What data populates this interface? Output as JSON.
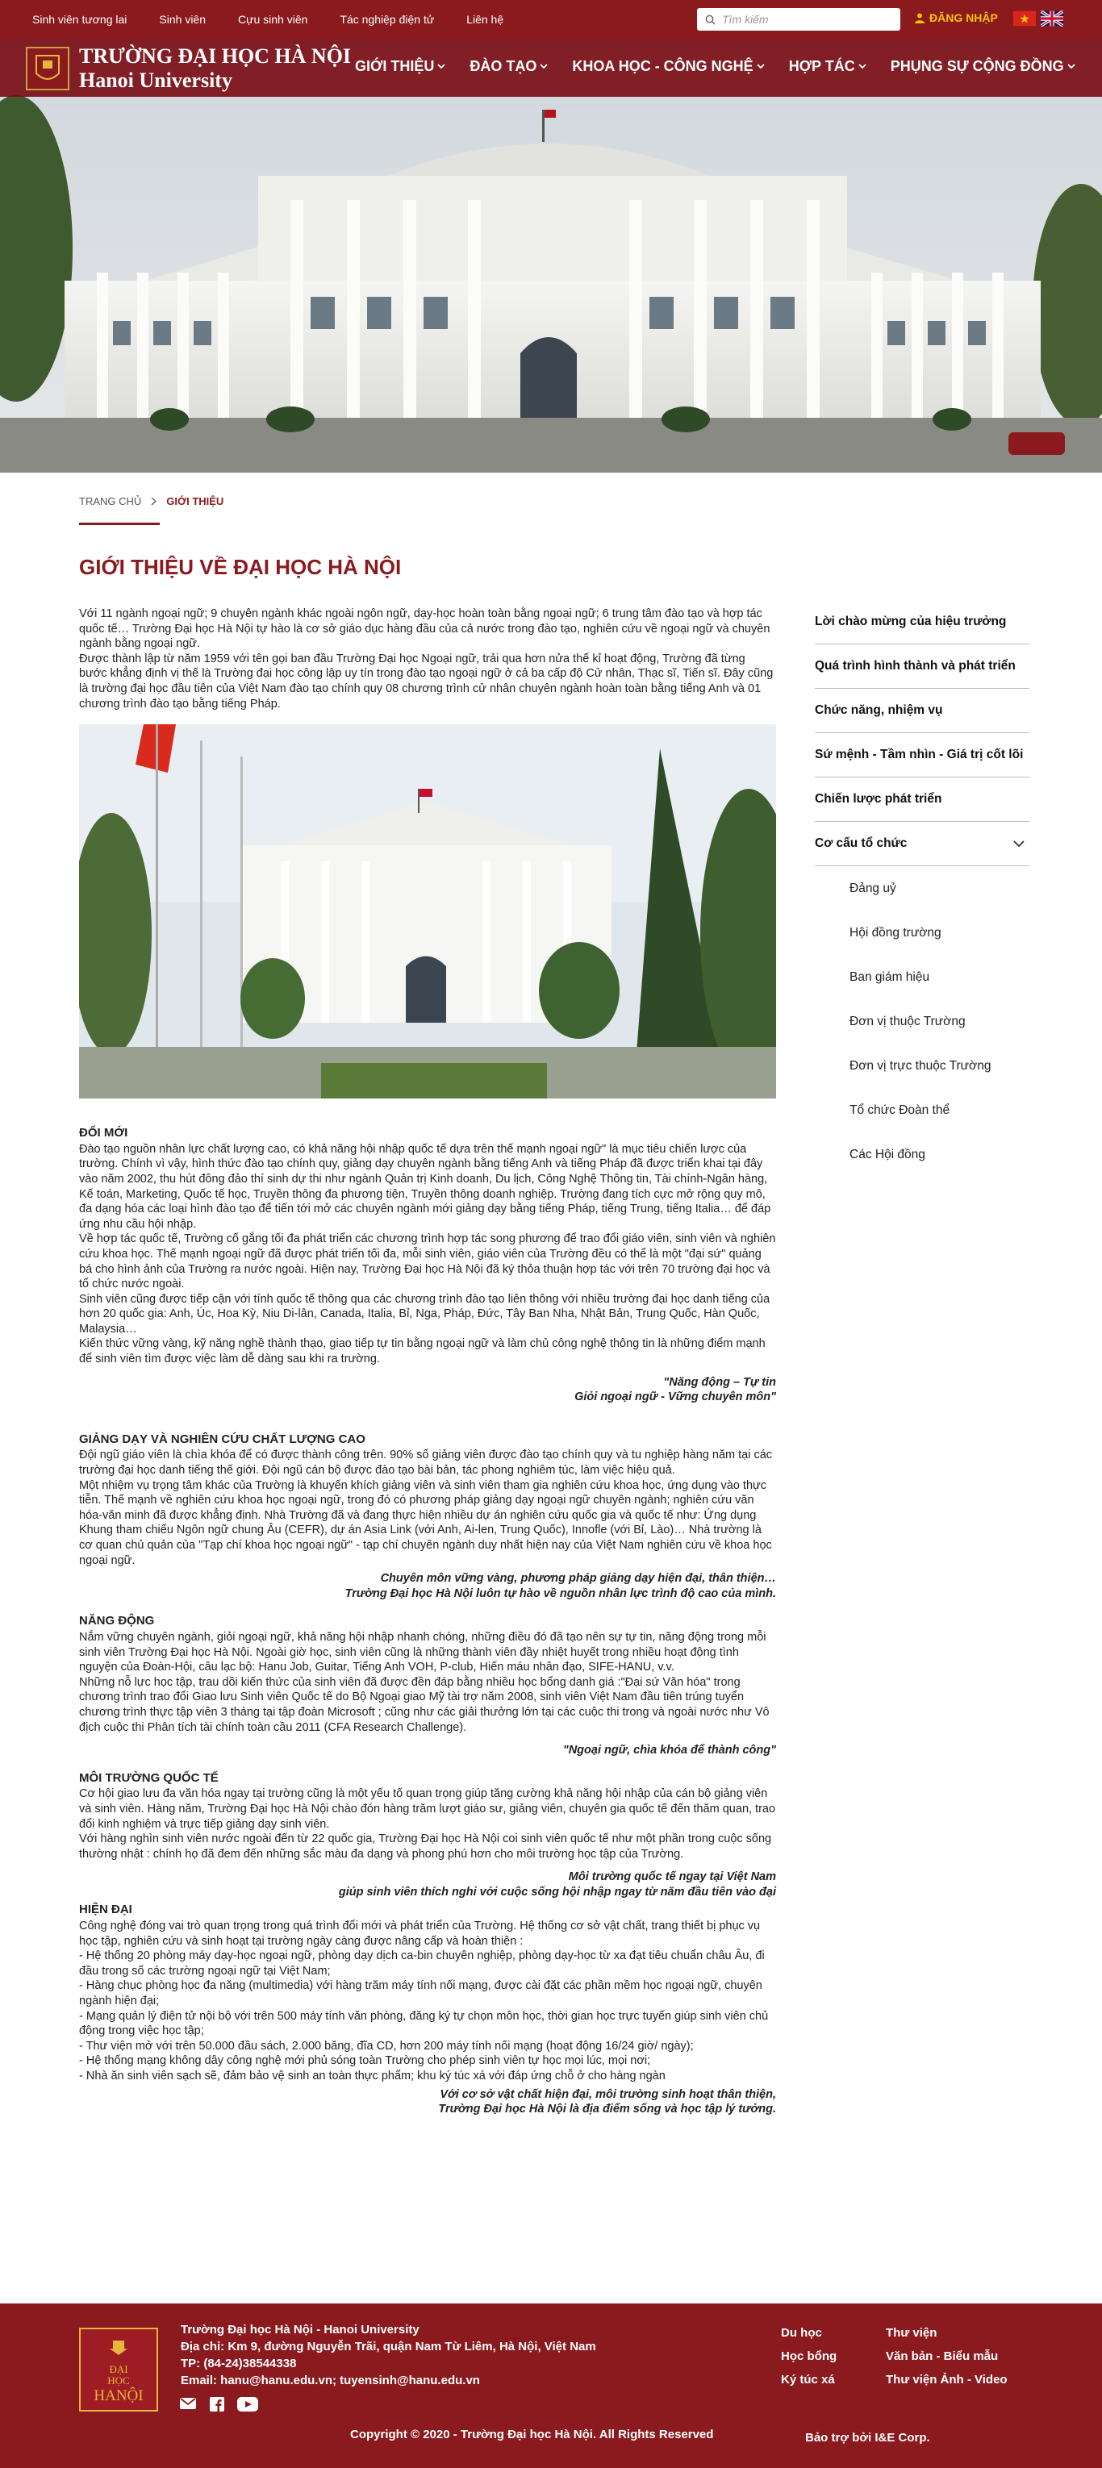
{
  "topbar": {
    "links": [
      "Sinh viên tương lai",
      "Sinh viên",
      "Cựu sinh viên",
      "Tác nghiệp điện tử",
      "Liên hệ"
    ],
    "search_placeholder": "Tìm kiếm",
    "login_label": "ĐĂNG NHẬP",
    "colors": {
      "bar": "#8b1a1f",
      "login": "#f5c400"
    }
  },
  "nav": {
    "brand_line1": "TRƯỜNG ĐẠI HỌC HÀ NỘI",
    "brand_line2": "Hanoi University",
    "menu": [
      "GIỚI THIỆU",
      "ĐÀO TẠO",
      "KHOA HỌC - CÔNG NGHỆ",
      "HỢP TÁC",
      "PHỤNG SỰ CỘNG ĐỒNG"
    ]
  },
  "breadcrumb": {
    "home": "TRANG CHỦ",
    "current": "GIỚI THIỆU"
  },
  "page_title": "GIỚI THIỆU VỀ ĐẠI HỌC HÀ NỘI",
  "content": {
    "intro": [
      "Với 11 ngành ngoại ngữ; 9 chuyên ngành khác ngoài ngôn ngữ, dạy-học hoàn toàn bằng ngoại ngữ; 6 trung tâm đào tạo và hợp tác quốc tế… Trường Đại học Hà Nội tự hào là cơ sở giáo dục hàng đầu của cả nước trong đào tạo, nghiên cứu về ngoại ngữ và chuyên ngành bằng ngoại ngữ.",
      "Được thành lập từ năm 1959 với tên gọi ban đầu Trường Đại học Ngoại ngữ, trải qua hơn nửa thế kỉ hoạt động, Trường đã từng bước khẳng định vị thế là Trường đại học công lập uy tín trong đào tạo ngoại ngữ ở cả ba cấp độ Cử nhân, Thạc sĩ, Tiến sĩ. Đây cũng là trường đại học đầu tiên của Việt Nam đào tạo chính quy 08 chương trình cử nhân chuyên ngành hoàn toàn bằng tiếng Anh và 01 chương trình đào tạo bằng tiếng Pháp."
    ],
    "s1_title": "ĐỔI MỚI",
    "s1": [
      "Đào tạo nguồn nhân lực chất lượng cao, có khả năng hội nhập quốc tế dựa trên thế mạnh ngoại ngữ\" là mục tiêu chiến lược của trường. Chính vì vậy, hình thức đào tạo chính quy, giảng dạy chuyên ngành bằng tiếng Anh và tiếng Pháp đã được triển khai tại đây vào năm 2002, thu hút đông đảo thí sinh dự thi như ngành Quản trị Kinh doanh, Du lịch, Công Nghệ Thông tin, Tài chính-Ngân hàng, Kế toán, Marketing, Quốc tế học, Truyền thông đa phương tiện, Truyền thông doanh nghiệp. Trường đang tích cực mở rộng quy mô, đa dạng hóa các loại hình đào tạo để tiến tới mở các chuyên ngành mới giảng dạy bằng tiếng Pháp, tiếng Trung, tiếng Italia… để đáp ứng nhu cầu hội nhập.",
      "Về hợp tác quốc tế, Trường cố gắng tối đa phát triển các chương trình hợp tác song phương để trao đổi giáo viên, sinh viên và nghiên cứu khoa học. Thế mạnh ngoại ngữ đã được phát triển tối đa, mỗi sinh viên, giáo viên của Trường đều có thể là một \"đại sứ\" quảng bá cho hình ảnh của Trường ra nước ngoài. Hiện nay, Trường Đại học Hà Nội đã ký thỏa thuận hợp tác với trên 70 trường đại học và tổ chức nước ngoài.",
      "Sinh viên cũng được tiếp cận với tính quốc tế thông qua các chương trình đào tạo liên thông với nhiều trường đại học danh tiếng của hơn 20 quốc gia: Anh, Úc, Hoa Kỳ, Niu Di-lân, Canada, Italia, Bỉ, Nga, Pháp, Đức, Tây Ban Nha, Nhật Bản, Trung Quốc, Hàn Quốc, Malaysia…",
      "Kiến thức vững vàng, kỹ năng nghề thành thạo, giao tiếp tự tin bằng ngoại ngữ và làm chủ công nghệ thông tin là những điểm mạnh để sinh viên tìm được việc làm dễ dàng sau khi ra trường."
    ],
    "s1_quote": [
      "\"Năng động – Tự tin",
      "Giỏi ngoại ngữ - Vững chuyên môn\""
    ],
    "s2_title": "GIẢNG DẠY VÀ NGHIÊN CỨU CHẤT LƯỢNG CAO",
    "s2": [
      "Đội ngũ giáo viên là chìa khóa để có được thành công trên. 90% số giảng viên được đào tạo chính quy và tu nghiệp hàng năm tại các trường đại học danh tiếng thế giới. Đội ngũ cán bộ được đào tạo bài bản, tác phong nghiêm túc, làm việc hiệu quả.",
      "Một nhiệm vụ trọng tâm khác của Trường là khuyến khích giảng viên và sinh viên tham gia nghiên cứu khoa học, ứng dụng vào thực tiễn. Thế mạnh về nghiên cứu khoa học ngoại ngữ, trong đó có phương pháp giảng dạy ngoại ngữ chuyên ngành; nghiên cứu văn hóa-văn minh đã được khẳng định. Nhà Trường đã và đang thực hiện nhiều dự án nghiên cứu quốc gia và quốc tế như: Ứng dụng Khung tham chiếu Ngôn ngữ chung Âu (CEFR), dự án Asia Link (với Anh, Ai-len, Trung Quốc), Innofle (với Bỉ, Lào)… Nhà trường là cơ quan chủ quản của \"Tạp chí khoa học ngoại ngữ\" - tạp chí chuyên ngành duy nhất hiện nay của Việt Nam nghiên cứu về khoa học ngoại ngữ."
    ],
    "s2_quote": [
      "Chuyên môn vững vàng, phương pháp giảng dạy hiện đại, thân thiện…",
      "Trường Đại học Hà Nội luôn tự hào về nguồn nhân lực trình độ cao của mình."
    ],
    "s3_title": "NĂNG ĐỘNG",
    "s3": [
      "Nắm vững chuyên ngành, giỏi ngoại ngữ, khả năng hội nhập nhanh chóng, những điều đó đã tạo nên sự tự tin, năng động trong mỗi sinh viên Trường Đại học Hà Nội. Ngoài giờ học, sinh viên cũng là những thành viên đầy nhiệt huyết trong nhiều hoạt động tình nguyện của Đoàn-Hội, câu lạc bộ: Hanu Job, Guitar, Tiếng Anh VOH, P-club, Hiến máu nhân đạo, SIFE-HANU, v.v.",
      "Những nỗ lực học tập, trau dồi kiến thức của sinh viên đã được đền đáp bằng nhiều học bổng danh giá :\"Đại sứ Văn hóa\" trong chương trình trao đổi Giao lưu Sinh viên Quốc tế do Bộ Ngoại giao Mỹ tài trợ năm 2008, sinh viên Việt Nam đầu tiên trúng tuyển chương trình thực tập viên 3 tháng tại tập đoàn Microsoft ; cũng như các giải thưởng lớn tại các cuộc thi trong và ngoài nước như Vô địch cuộc thi Phân tích tài chính toàn cầu 2011 (CFA Research Challenge)."
    ],
    "s3_quote": [
      "\"Ngoại ngữ, chìa khóa để thành công\""
    ],
    "s4_title": "MÔI TRƯỜNG QUỐC TẾ",
    "s4": [
      "Cơ hội giao lưu đa văn hóa ngay tại trường cũng là một yếu tố quan trọng giúp tăng cường khả năng hội nhập của cán bộ giảng viên và sinh viên. Hàng năm, Trường Đại học Hà Nội chào đón hàng trăm lượt giáo sư, giảng viên, chuyên gia quốc tế đến thăm quan, trao đổi kinh nghiệm và trực tiếp giảng dạy sinh viên.",
      "Với hàng nghìn sinh viên nước ngoài đến từ 22 quốc gia, Trường Đại học Hà Nội coi sinh viên quốc tế như một phần trong cuộc sống thường nhật : chính họ đã đem đến những sắc màu đa dạng và phong phú hơn cho môi trường học tập của Trường."
    ],
    "s4_quote": [
      "Môi trường quốc tế ngay tại Việt Nam",
      "giúp sinh viên thích nghi với cuộc sống hội nhập ngay từ năm đầu tiên vào đại"
    ],
    "s5_title": "HIỆN ĐẠI",
    "s5": [
      "Công nghệ đóng vai trò quan trọng trong quá trình đổi mới và phát triển của Trường. Hệ thống cơ sở vật chất, trang thiết bị phục vụ học tập, nghiên cứu và sinh hoạt tại trường ngày càng được nâng cấp và hoàn thiện :",
      "- Hệ thống 20 phòng máy dạy-học ngoại ngữ, phòng dạy dịch ca-bin chuyên nghiệp, phòng dạy-học từ xa đạt tiêu chuẩn châu Âu, đi đầu trong số các trường ngoại ngữ tại Việt Nam;",
      "- Hàng chục phòng học đa năng (multimedia) với hàng trăm máy tính nối mạng, được cài đặt các phần mềm học ngoại ngữ, chuyên ngành hiện đại;",
      "- Mạng quản lý điện tử nội bộ với trên 500 máy tính văn phòng, đăng ký tự chọn môn học, thời gian học trực tuyến giúp sinh viên chủ động trong việc học tập;",
      "- Thư viện mở với trên 50.000 đầu sách, 2.000 băng, đĩa CD, hơn 200 máy tính nối mạng (hoạt động 16/24 giờ/ ngày);",
      "- Hệ thống mạng không dây công nghệ mới phủ sóng toàn Trường cho phép sinh viên tự học mọi lúc, mọi nơi;",
      "- Nhà ăn sinh viên sạch sẽ, đảm bảo vệ sinh an toàn thực phẩm; khu ký túc xá với đáp ứng chỗ ở cho hàng ngàn"
    ],
    "s5_quote": [
      "Với cơ sở vật chất hiện đại, môi trường sinh hoạt thân thiện,",
      "Trường Đại học Hà Nội là địa điểm sống và học tập lý tưởng."
    ]
  },
  "sidebar": {
    "items": [
      "Lời chào mừng của hiệu trưởng",
      "Quá trình hình thành và phát triển",
      "Chức năng, nhiệm vụ",
      "Sứ mệnh - Tầm nhìn - Giá trị cốt lõi",
      "Chiến lược phát triển",
      "Cơ cấu tổ chức"
    ],
    "subitems": [
      "Đảng uỷ",
      "Hội đồng trường",
      "Ban giám hiệu",
      "Đơn vị thuộc Trường",
      "Đơn vị trực thuộc Trường",
      "Tổ chức Đoàn thể",
      "Các Hội đồng"
    ]
  },
  "footer": {
    "logo_line1": "ĐẠI",
    "logo_line2": "HỌC",
    "logo_line3": "HANỘI",
    "info": [
      "Trường Đại học Hà Nội - Hanoi University",
      "Địa chỉ: Km 9, đường Nguyễn Trãi, quận Nam Từ Liêm, Hà Nội, Việt Nam",
      "TP: (84-24)38544338",
      "Email: hanu@hanu.edu.vn; tuyensinh@hanu.edu.vn"
    ],
    "links_col1": [
      "Du học",
      "Học bổng",
      "Ký túc xá"
    ],
    "links_col2": [
      "Thư viện",
      "Văn bản - Biểu mẫu",
      "Thư viện Ảnh - Video"
    ],
    "copyright": "Copyright © 2020 - Trường Đại học Hà Nội. All Rights Reserved",
    "sponsor": "Bảo trợ bởi I&E Corp."
  }
}
